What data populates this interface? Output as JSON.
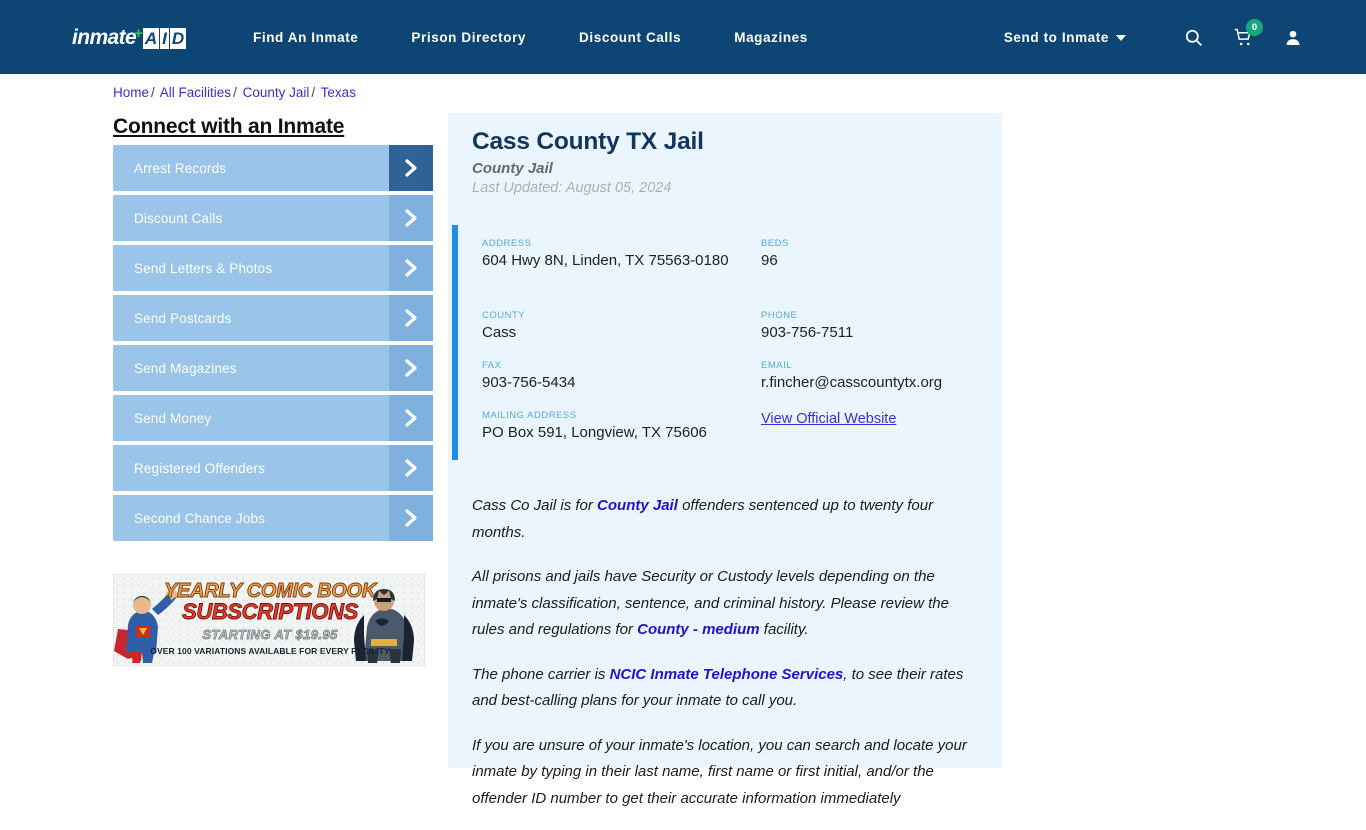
{
  "header": {
    "logo": {
      "word": "inmate",
      "plus": "+",
      "aid": [
        "A",
        "I",
        "D"
      ]
    },
    "nav": [
      {
        "label": "Find An Inmate"
      },
      {
        "label": "Prison Directory"
      },
      {
        "label": "Discount Calls"
      },
      {
        "label": "Magazines"
      }
    ],
    "dropdown": {
      "label": "Send to Inmate",
      "icon": "chevron-down-icon"
    },
    "search_icon": "search-icon",
    "cart": {
      "icon": "cart-icon",
      "badge": "0"
    },
    "account_icon": "user-icon",
    "colors": {
      "bar": "#0d4675",
      "badge": "#16a878"
    }
  },
  "breadcrumb": {
    "items": [
      "Home",
      "All Facilities",
      "County Jail",
      "Texas"
    ],
    "separator": "/"
  },
  "sidebar": {
    "title": "Connect with an Inmate",
    "items": [
      {
        "label": "Arrest Records"
      },
      {
        "label": "Discount Calls"
      },
      {
        "label": "Send Letters & Photos"
      },
      {
        "label": "Send Postcards"
      },
      {
        "label": "Send Magazines"
      },
      {
        "label": "Send Money"
      },
      {
        "label": "Registered Offenders"
      },
      {
        "label": "Second Chance Jobs"
      }
    ],
    "chevron_icon": "chevron-right-icon"
  },
  "ad": {
    "line1": "YEARLY COMIC BOOK",
    "line2": "SUBSCRIPTIONS",
    "line3": "STARTING AT $19.95",
    "line4": "OVER 100 VARIATIONS AVAILABLE FOR EVERY FACILITY"
  },
  "facility": {
    "title": "Cass County TX Jail",
    "type": "County Jail",
    "last_updated": "Last Updated: August 05, 2024",
    "fields": {
      "address_label": "ADDRESS",
      "address_value": "604 Hwy 8N, Linden, TX 75563-0180",
      "beds_label": "BEDS",
      "beds_value": "96",
      "county_label": "COUNTY",
      "county_value": "Cass",
      "phone_label": "PHONE",
      "phone_value": "903-756-7511",
      "fax_label": "FAX",
      "fax_value": "903-756-5434",
      "email_label": "EMAIL",
      "email_value": "r.fincher@casscountytx.org",
      "mailing_label": "MAILING ADDRESS",
      "mailing_value": "PO Box 591, Longview, TX 75606",
      "website_link": "View Official Website"
    },
    "accent_color": "#1f8fea"
  },
  "body": {
    "p1_a": "Cass Co Jail is for ",
    "p1_b": "County Jail",
    "p1_c": " offenders sentenced up to twenty four months.",
    "p2_a": "All prisons and jails have Security or Custody levels depending on the inmate's classification, sentence, and criminal history. Please review the rules and regulations for ",
    "p2_b": "County - medium",
    "p2_c": " facility.",
    "p3_a": "The phone carrier is ",
    "p3_b": "NCIC Inmate Telephone Services",
    "p3_c": ", to see their rates and best-calling plans for your inmate to call you.",
    "p4": "If you are unsure of your inmate's location, you can search and locate your inmate by typing in their last name, first name or first initial, and/or the offender ID number to get their accurate information immediately"
  }
}
